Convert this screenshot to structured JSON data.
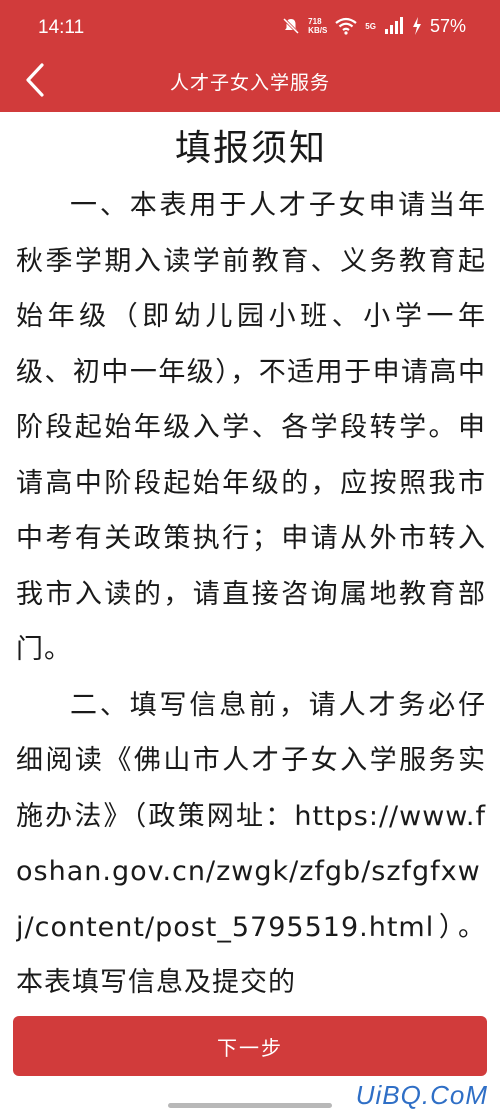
{
  "status_bar": {
    "time": "14:11",
    "net_speed_value": "718",
    "net_speed_unit": "KB/S",
    "network_label": "5G",
    "battery": "57%"
  },
  "header": {
    "title": "人才子女入学服务"
  },
  "document": {
    "title": "填报须知",
    "paragraphs": [
      "一、本表用于人才子女申请当年秋季学期入读学前教育、义务教育起始年级（即幼儿园小班、小学一年级、初中一年级），不适用于申请高中阶段起始年级入学、各学段转学。申请高中阶段起始年级的，应按照我市中考有关政策执行；申请从外市转入我市入读的，请直接咨询属地教育部门。",
      "二、填写信息前，请人才务必仔细阅读《佛山市人才子女入学服务实施办法》（政策网址：https://www.foshan.gov.cn/zwgk/zfgb/szfgfxwj/content/post_5795519.html）。本表填写信息及提交的"
    ]
  },
  "footer": {
    "next_label": "下一步"
  },
  "watermark": "UiBQ.CoM",
  "colors": {
    "accent": "#d13b3b",
    "watermark": "#2f6fc6"
  }
}
